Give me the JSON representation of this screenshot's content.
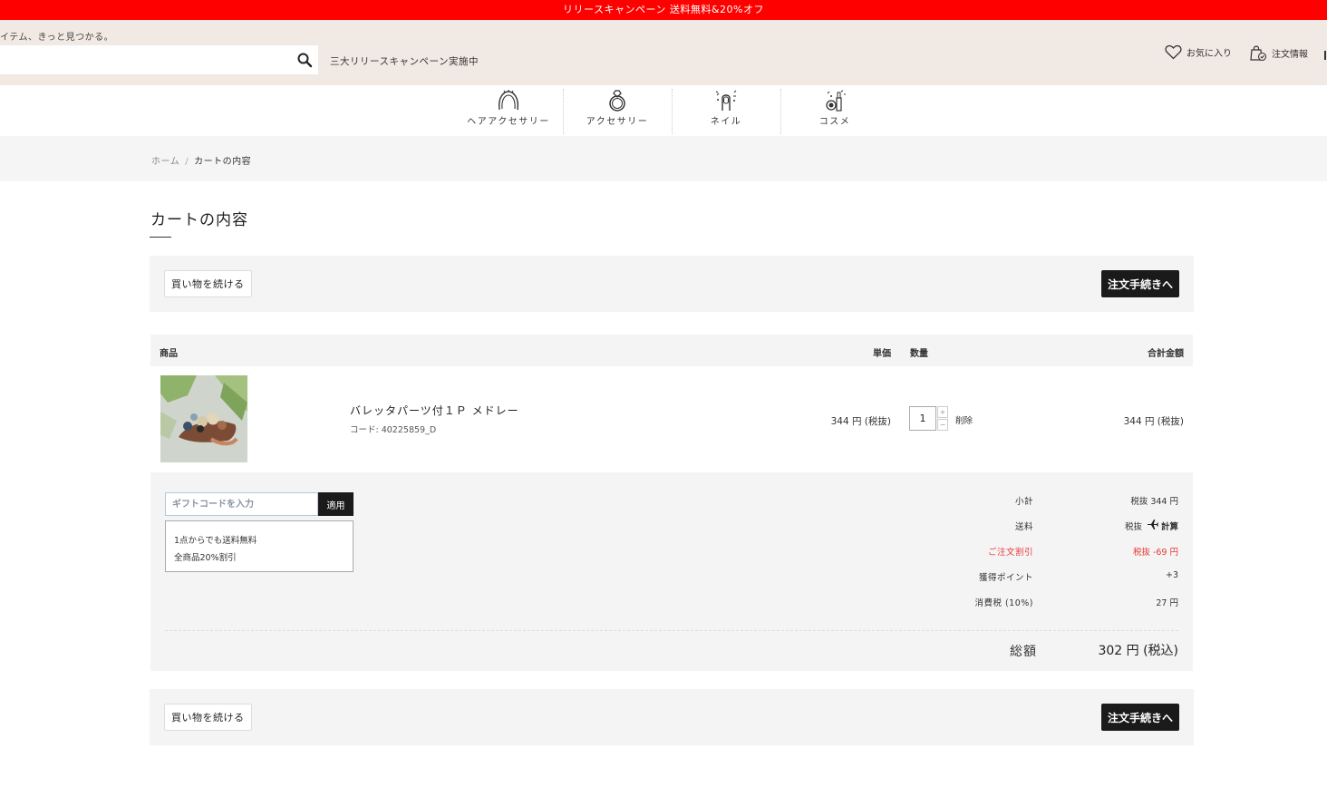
{
  "promo": {
    "text": "リリースキャンペーン 送料無料&20%オフ"
  },
  "header": {
    "tagline": "イテム、きっと見つかる。",
    "search": {
      "placeholder": "",
      "value": ""
    },
    "campaign_text": "三大リリースキャンペーン実施中",
    "favorites_label": "お気に入り",
    "orders_label": "注文情報"
  },
  "categories": [
    {
      "label": "ヘアアクセサリー",
      "icon": "hair-accessory-icon"
    },
    {
      "label": "アクセサリー",
      "icon": "ring-icon"
    },
    {
      "label": "ネイル",
      "icon": "nail-icon"
    },
    {
      "label": "コスメ",
      "icon": "cosmetics-icon"
    }
  ],
  "breadcrumb": {
    "home": "ホーム",
    "sep": "/",
    "current": "カートの内容"
  },
  "page_title": "カートの内容",
  "actions": {
    "continue_label": "買い物を続ける",
    "checkout_label": "注文手続きへ"
  },
  "cart": {
    "headers": {
      "product": "商品",
      "unit_price": "単価",
      "quantity": "数量",
      "total": "合計金額"
    },
    "items": [
      {
        "name": "バレッタパーツ付１Ｐ メドレー",
        "code": "コード: 40225859_D",
        "unit_price": "344 円 (税抜)",
        "quantity": "1",
        "delete_label": "削除",
        "line_total": "344 円 (税抜)"
      }
    ]
  },
  "gift": {
    "placeholder": "ギフトコードを入力",
    "apply_label": "適用",
    "notice_lines": [
      "1点からでも送料無料",
      "全商品20%割引"
    ]
  },
  "summary": {
    "rows": [
      {
        "label": "小計",
        "value": "税抜 344 円"
      },
      {
        "label": "送料",
        "value_prefix": "税抜",
        "value_link": "計算"
      },
      {
        "label": "ご注文割引",
        "value": "税抜 -69 円"
      },
      {
        "label": "獲得ポイント",
        "value": "+3"
      },
      {
        "label": "消費税 (10%)",
        "value": "27 円"
      }
    ],
    "total_label": "総額",
    "total_value": "302 円 (税込)"
  },
  "colors": {
    "promo": "#ff0000",
    "header_bg": "#f1e9e3",
    "discount": "#e53935",
    "checkout_btn": "#1a1a1a"
  }
}
